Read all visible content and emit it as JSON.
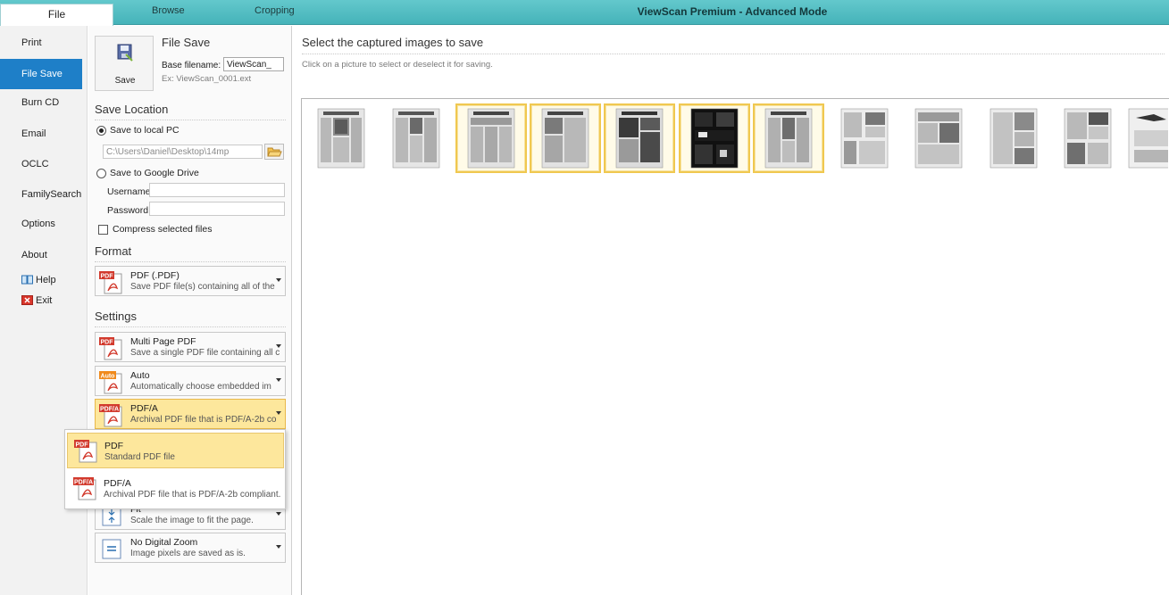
{
  "window": {
    "title": "ViewScan Premium - Advanced Mode"
  },
  "ribbon": {
    "tabs": [
      "File",
      "Browse",
      "Cropping"
    ]
  },
  "nav": {
    "items": [
      "Print",
      "File Save",
      "Burn CD",
      "Email",
      "OCLC",
      "FamilySearch",
      "Options",
      "About",
      "Help",
      "Exit"
    ],
    "active": "File Save"
  },
  "file_save": {
    "save_button": "Save",
    "title": "File Save",
    "base_filename_label": "Base filename:",
    "base_filename_value": "ViewScan_",
    "example": "Ex: ViewScan_0001.ext"
  },
  "save_location": {
    "title": "Save Location",
    "local_label": "Save to local PC",
    "local_selected": true,
    "path_value": "C:\\Users\\Daniel\\Desktop\\14mp",
    "google_label": "Save to Google Drive",
    "username_label": "Username",
    "password_label": "Password",
    "compress_label": "Compress selected files",
    "compress_checked": false
  },
  "format": {
    "title": "Format",
    "selected": {
      "title": "PDF (.PDF)",
      "desc": "Save PDF file(s) containing all of the"
    }
  },
  "settings": {
    "title": "Settings",
    "dropdowns": [
      {
        "icon": "PDF",
        "title": "Multi Page PDF",
        "desc": "Save a single PDF file containing all c"
      },
      {
        "icon": "Auto",
        "title": "Auto",
        "desc": "Automatically choose embedded im"
      },
      {
        "icon": "PDF/A",
        "title": "PDF/A",
        "desc": "Archival PDF file that is PDF/A-2b co",
        "open": true
      },
      {
        "icon": "fit",
        "title": "Fit",
        "desc": "Scale the image to fit the page."
      },
      {
        "icon": "zoom",
        "title": "No Digital Zoom",
        "desc": "Image pixels are saved as is."
      }
    ]
  },
  "popup": {
    "options": [
      {
        "icon": "PDF",
        "title": "PDF",
        "desc": "Standard PDF file",
        "highlighted": true
      },
      {
        "icon": "PDF/A",
        "title": "PDF/A",
        "desc": "Archival PDF file that is PDF/A-2b compliant.",
        "highlighted": false
      }
    ]
  },
  "main": {
    "title": "Select the captured images to save",
    "subtitle": "Click on a picture to select or deselect it for saving.",
    "thumbnails": [
      {
        "kind": "news1",
        "selected": false
      },
      {
        "kind": "news2",
        "selected": false
      },
      {
        "kind": "news3",
        "selected": true
      },
      {
        "kind": "news4",
        "selected": true
      },
      {
        "kind": "news5",
        "selected": true
      },
      {
        "kind": "dark",
        "selected": true
      },
      {
        "kind": "news6",
        "selected": true
      },
      {
        "kind": "ads1",
        "selected": false
      },
      {
        "kind": "ads2",
        "selected": false
      },
      {
        "kind": "ads3",
        "selected": false
      },
      {
        "kind": "ads4",
        "selected": false
      },
      {
        "kind": "ads5",
        "selected": false
      }
    ]
  },
  "colors": {
    "ribbon": "#4fbcc1",
    "active_nav": "#1e7fc8",
    "selected_border": "#f0c850",
    "highlight": "#fde79c"
  }
}
